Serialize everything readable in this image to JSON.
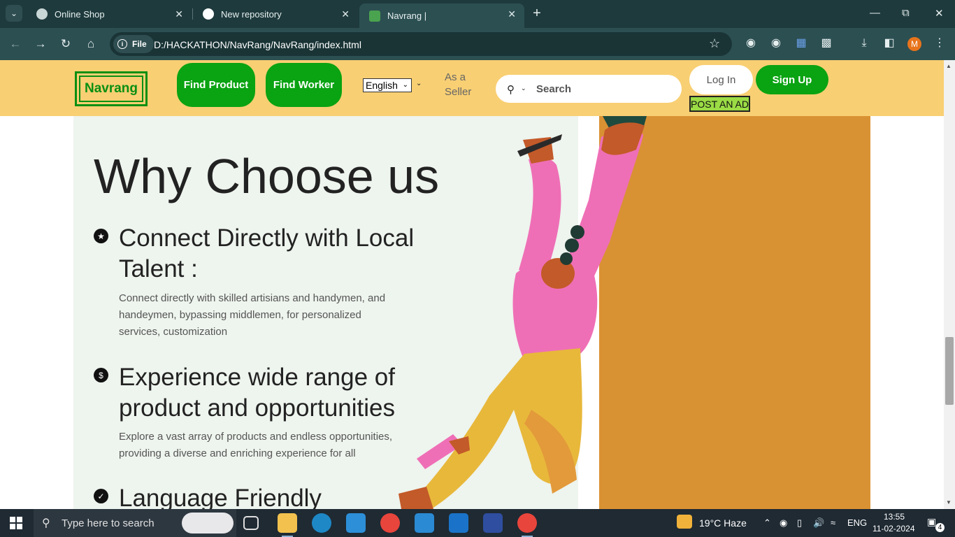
{
  "browser": {
    "tabs": [
      {
        "title": "Online Shop",
        "icon": "globe-icon",
        "active": false
      },
      {
        "title": "New repository",
        "icon": "github-icon",
        "active": false
      },
      {
        "title": "Navrang |",
        "icon": "page-favicon-icon",
        "active": true
      }
    ],
    "file_label": "File",
    "url": "D:/HACKATHON/NavRang/NavRang/index.html"
  },
  "header": {
    "logo": "Navrang",
    "find_product": "Find Product",
    "find_worker": "Find Worker",
    "language": "English",
    "seller": "As a Seller",
    "search_placeholder": "Search",
    "login": "Log In",
    "signup": "Sign Up",
    "post_ad": "POST AN AD"
  },
  "main": {
    "heading": "Why Choose us",
    "features": [
      {
        "icon": "star-icon",
        "title": "Connect Directly with Local Talent :",
        "description": "Connect directly with skilled artisians and handymen, and handeymen, bypassing middlemen, for personalized services, customization"
      },
      {
        "icon": "dollar-icon",
        "title": "Experience wide range of product and opportunities",
        "description": "Explore a vast array of products and endless opportunities, providing a diverse and enriching experience for all"
      },
      {
        "icon": "check-icon",
        "title": "Language Friendly",
        "description": ""
      }
    ]
  },
  "taskbar": {
    "search_placeholder": "Type here to search",
    "weather": "19°C  Haze",
    "language": "ENG",
    "time": "13:55",
    "date": "11-02-2024",
    "notifications": "4"
  },
  "colors": {
    "header_bg": "#f8cf73",
    "green": "#0aa312",
    "panel_bg": "#eef4ee",
    "orange": "#d99233",
    "post_ad_bg": "#9bdc45"
  }
}
